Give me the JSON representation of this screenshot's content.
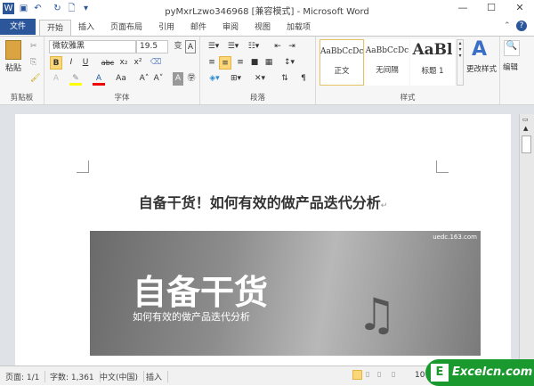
{
  "window": {
    "title": "pyMxrLzwo346968 [兼容模式] - Microsoft Word",
    "minimize": "—",
    "maximize": "☐",
    "close": "✕"
  },
  "tabs": [
    "文件",
    "开始",
    "插入",
    "页面布局",
    "引用",
    "邮件",
    "审阅",
    "视图",
    "加载项"
  ],
  "ribbon": {
    "clipboard": {
      "paste": "粘贴",
      "label": "剪贴板"
    },
    "font": {
      "name": "微软雅黑",
      "size": "19.5",
      "bold": "B",
      "italic": "I",
      "underline": "U",
      "strike": "abc",
      "sub": "x₂",
      "sup": "x²",
      "grow": "A˄",
      "shrink": "A˅",
      "case": "Aa",
      "label": "字体"
    },
    "paragraph": {
      "label": "段落"
    },
    "styles": {
      "items": [
        {
          "sample": "AaBbCcDc",
          "name": "正文"
        },
        {
          "sample": "AaBbCcDc",
          "name": "无间隔"
        },
        {
          "sample": "AaBl",
          "name": "标题 1"
        }
      ],
      "change": "更改样式",
      "label": "样式"
    },
    "edit": {
      "label": "编辑"
    }
  },
  "document": {
    "heading": "自备干货！如何有效的做产品迭代分析",
    "image": {
      "source": "uedc.163.com",
      "big": "自备干货",
      "sub": "如何有效的做产品迭代分析"
    }
  },
  "status": {
    "page": "页面: 1/1",
    "words": "字数: 1,361",
    "lang": "中文(中国)",
    "mode": "插入",
    "zoom": "10"
  },
  "watermark": "Excelcn.com"
}
